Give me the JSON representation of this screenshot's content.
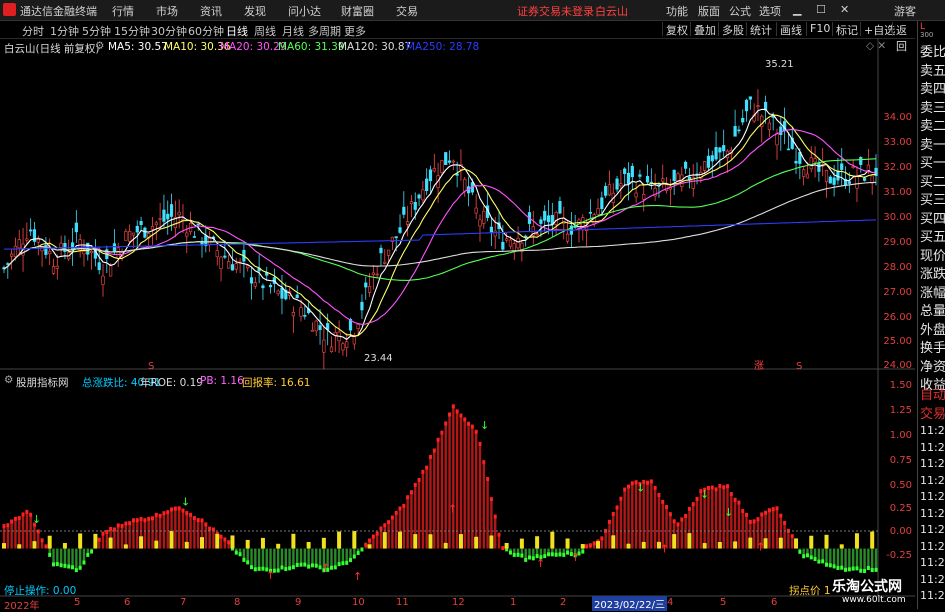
{
  "menubar": {
    "app_title": "通达信金融终端",
    "items": [
      "行情",
      "市场",
      "资讯",
      "发现",
      "问小达",
      "财富圈",
      "交易"
    ],
    "notice": "证券交易未登录",
    "stock": "白云山",
    "right_items": [
      "功能",
      "版面",
      "公式",
      "选项"
    ],
    "guest": "游客"
  },
  "toolbar": {
    "periods": [
      "分时",
      "1分钟",
      "5分钟",
      "15分钟",
      "30分钟",
      "60分钟",
      "日线",
      "周线",
      "月线",
      "多周期",
      "更多"
    ],
    "active_period": "日线",
    "buttons": [
      "复权",
      "叠加",
      "多股",
      "统计",
      "画线",
      "F10",
      "标记",
      "+自选",
      "返回"
    ]
  },
  "sidebar": {
    "corner": "L",
    "corner_num": "300",
    "items": [
      "委比",
      "卖五",
      "卖四",
      "卖三",
      "卖二",
      "卖一",
      "买一",
      "买二",
      "买三",
      "买四",
      "买五",
      "现价",
      "涨跌",
      "涨幅",
      "总量",
      "外盘",
      "换手",
      "净资",
      "收益"
    ],
    "auto_items": [
      "自动",
      "交易"
    ],
    "time_items": [
      "11:29",
      "11:29",
      "11:29",
      "11:29",
      "11:29",
      "11:29",
      "11:29",
      "11:29",
      "11:29",
      "11:29",
      "11:29"
    ]
  },
  "price_header": {
    "name": "白云山(日线 前复权)",
    "ma": [
      {
        "label": "MA5: 30.57",
        "color": "#ffffff"
      },
      {
        "label": "MA10: 30.36",
        "color": "#ffff66"
      },
      {
        "label": "MA20: 30.29",
        "color": "#ff55ff"
      },
      {
        "label": "MA60: 31.39",
        "color": "#55ff55"
      },
      {
        "label": "MA120: 30.87",
        "color": "#dddddd"
      },
      {
        "label": "MA250: 28.78",
        "color": "#2a3cff"
      }
    ],
    "high_label": "35.21",
    "low_label": "23.44",
    "marks": [
      "S",
      "涨",
      "S"
    ]
  },
  "price_axis": [
    "34.00",
    "33.00",
    "32.00",
    "31.00",
    "30.00",
    "29.00",
    "28.00",
    "27.00",
    "26.00",
    "25.00",
    "24.00"
  ],
  "indicator_header": {
    "name": "股朋指标网",
    "items": [
      {
        "label": "总涨跌比: 40.91",
        "color": "#00ccff"
      },
      {
        "label": "年ROE: 0.19",
        "color": "#dddddd"
      },
      {
        "label": "PB: 1.16",
        "color": "#ff66ff"
      },
      {
        "label": "回报率: 16.61",
        "color": "#ffcc33"
      }
    ]
  },
  "indicator_axis": [
    "1.50",
    "1.25",
    "1.00",
    "0.75",
    "0.50",
    "0.25",
    "0.00",
    "-0.25"
  ],
  "indicator_labels": {
    "stop": "停止操作: 0.00",
    "turn": "拐点价 1"
  },
  "x_axis": [
    "2022年",
    "5",
    "6",
    "7",
    "8",
    "9",
    "10",
    "11",
    "12",
    "1",
    "2",
    "2023/02/22/三",
    "4",
    "5",
    "6"
  ],
  "watermark": {
    "title": "乐淘公式网",
    "url": "www.60lt.com"
  },
  "chart_data": {
    "type": "candlestick",
    "title": "白云山(日线 前复权)",
    "price_range": [
      23.44,
      35.21
    ],
    "high": 35.21,
    "low": 23.44,
    "ma_current": {
      "MA5": 30.57,
      "MA10": 30.36,
      "MA20": 30.29,
      "MA60": 31.39,
      "MA120": 30.87,
      "MA250": 28.78
    },
    "close_trend": [
      26.8,
      28.5,
      27.2,
      28.0,
      26.9,
      28.2,
      28.6,
      29.0,
      28.0,
      27.2,
      26.5,
      25.8,
      25.2,
      24.0,
      24.3,
      27.0,
      28.5,
      30.5,
      31.5,
      29.0,
      28.0,
      28.3,
      28.7,
      28.5,
      29.5,
      30.5,
      30.0,
      30.2,
      31.0,
      31.5,
      33.5,
      32.5,
      31.3,
      30.5,
      30.6,
      30.8
    ],
    "indicator_range": [
      -0.25,
      1.5
    ],
    "indicator_trend": [
      0.2,
      0.35,
      -0.15,
      -0.2,
      0.15,
      0.25,
      0.3,
      0.4,
      0.25,
      0.05,
      -0.2,
      -0.2,
      -0.15,
      -0.2,
      -0.1,
      0.15,
      0.4,
      0.8,
      1.35,
      1.1,
      0.0,
      -0.1,
      -0.05,
      -0.05,
      0.1,
      0.6,
      0.65,
      0.2,
      0.55,
      0.6,
      0.25,
      0.4,
      -0.05,
      -0.15,
      -0.2,
      -0.2
    ]
  }
}
